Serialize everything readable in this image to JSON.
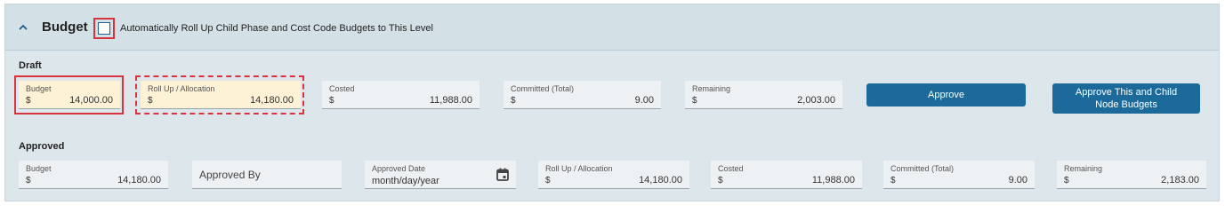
{
  "header": {
    "title": "Budget",
    "rollup_checkbox_label": "Automatically Roll Up Child Phase and Cost Code Budgets to This Level",
    "rollup_checked": false
  },
  "draft": {
    "section_label": "Draft",
    "fields": [
      {
        "label": "Budget",
        "currency": "$",
        "value": "14,000.00"
      },
      {
        "label": "Roll Up / Allocation",
        "currency": "$",
        "value": "14,180.00"
      },
      {
        "label": "Costed",
        "currency": "$",
        "value": "11,988.00"
      },
      {
        "label": "Committed (Total)",
        "currency": "$",
        "value": "9.00"
      },
      {
        "label": "Remaining",
        "currency": "$",
        "value": "2,003.00"
      }
    ],
    "approve_button": "Approve",
    "approve_children_button": "Approve This and Child Node Budgets"
  },
  "approved": {
    "section_label": "Approved",
    "budget": {
      "label": "Budget",
      "currency": "$",
      "value": "14,180.00"
    },
    "approved_by": {
      "placeholder": "Approved By"
    },
    "approved_date": {
      "label": "Approved Date",
      "placeholder": "month/day/year"
    },
    "rollup": {
      "label": "Roll Up / Allocation",
      "currency": "$",
      "value": "14,180.00"
    },
    "costed": {
      "label": "Costed",
      "currency": "$",
      "value": "11,988.00"
    },
    "committed": {
      "label": "Committed (Total)",
      "currency": "$",
      "value": "9.00"
    },
    "remaining": {
      "label": "Remaining",
      "currency": "$",
      "value": "2,183.00"
    }
  },
  "colors": {
    "accent": "#1b6a9a",
    "highlight": "#d9343d",
    "panel": "#dde6eb",
    "draft_editable": "#fdf2d5"
  },
  "icons": [
    "chevron-up-icon",
    "calendar-icon"
  ]
}
